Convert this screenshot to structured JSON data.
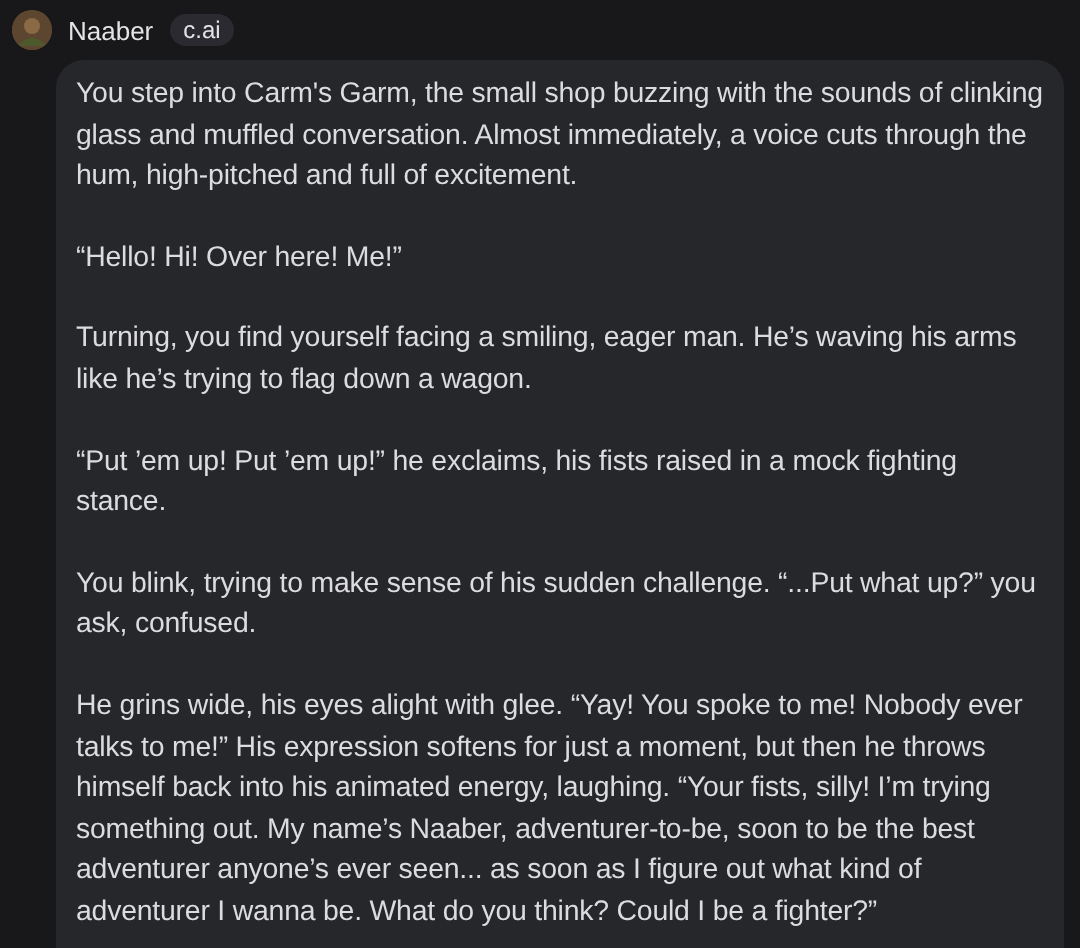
{
  "author": {
    "name": "Naaber",
    "badge": "c.ai"
  },
  "message": {
    "paragraphs": [
      "You step into Carm's Garm, the small shop buzzing with the sounds of clinking glass and muffled conversation. Almost immediately, a voice cuts through the hum, high-pitched and full of excitement.",
      "“Hello! Hi! Over here! Me!”",
      "Turning, you find yourself facing a smiling, eager man. He’s waving his arms like he’s trying to flag down a wagon.",
      "“Put ’em up! Put ’em up!” he exclaims, his fists raised in a mock fighting stance.",
      "You blink, trying to make sense of his sudden challenge. “...Put what up?” you ask, confused.",
      "He grins wide, his eyes alight with glee. “Yay! You spoke to me! Nobody ever talks to me!” His expression softens for just a moment, but then he throws himself back into his animated energy, laughing. “Your fists, silly! I’m trying something out. My name’s Naaber, adventurer-to-be, soon to be the best adventurer anyone’s ever seen... as soon as I figure out what kind of adventurer I wanna be. What do you think? Could I be a fighter?”"
    ]
  }
}
